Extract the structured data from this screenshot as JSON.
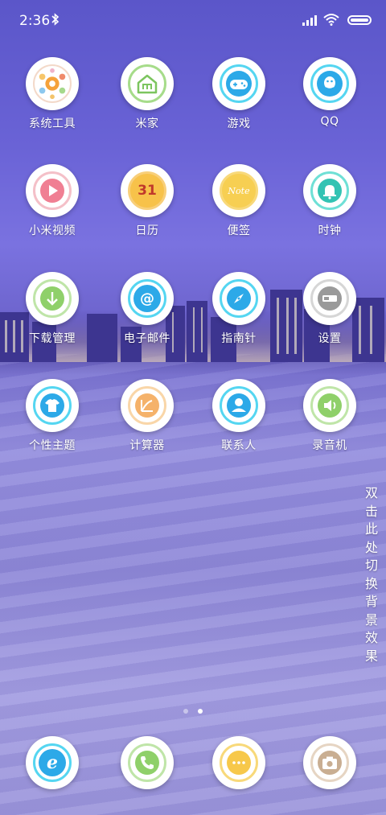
{
  "status_bar": {
    "time": "2:36"
  },
  "apps": [
    {
      "label": "系统工具",
      "icon": "system-tools-icon"
    },
    {
      "label": "米家",
      "icon": "mi-home-icon"
    },
    {
      "label": "游戏",
      "icon": "gamepad-icon"
    },
    {
      "label": "QQ",
      "icon": "qq-icon"
    },
    {
      "label": "小米视频",
      "icon": "play-icon"
    },
    {
      "label": "日历",
      "icon": "calendar-icon",
      "text": "31"
    },
    {
      "label": "便签",
      "icon": "note-icon",
      "text": "Note"
    },
    {
      "label": "时钟",
      "icon": "bell-icon"
    },
    {
      "label": "下载管理",
      "icon": "download-icon"
    },
    {
      "label": "电子邮件",
      "icon": "email-icon",
      "text": "@"
    },
    {
      "label": "指南针",
      "icon": "compass-icon"
    },
    {
      "label": "设置",
      "icon": "settings-toggle-icon"
    },
    {
      "label": "个性主题",
      "icon": "theme-shirt-icon"
    },
    {
      "label": "计算器",
      "icon": "calculator-icon"
    },
    {
      "label": "联系人",
      "icon": "contact-person-icon"
    },
    {
      "label": "录音机",
      "icon": "recorder-icon"
    }
  ],
  "page_indicator": {
    "total": 2,
    "active": 2
  },
  "wallpaper_hint": "双击此处切换背景效果",
  "dock": [
    {
      "icon": "browser-icon",
      "text": "e"
    },
    {
      "icon": "phone-icon"
    },
    {
      "icon": "messages-icon"
    },
    {
      "icon": "camera-icon"
    }
  ]
}
